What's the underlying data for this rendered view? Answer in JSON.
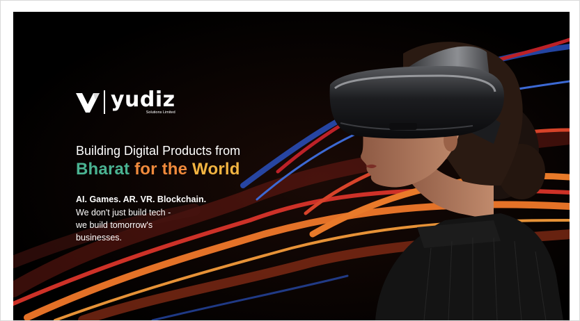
{
  "brand": {
    "name": "yudiz",
    "tagline": "Solutions Limited"
  },
  "headline": {
    "line1": "Building Digital Products from",
    "part_green": "Bharat",
    "part_orange": "for the",
    "part_yellow": "World"
  },
  "subheading": {
    "bold": "AI. Games. AR. VR. Blockchain.",
    "lines": [
      "We don't just build tech -",
      "we build tomorrow's",
      "businesses."
    ]
  },
  "colors": {
    "background": "#000000",
    "green": "#4ab392",
    "orange": "#f08a3c",
    "yellow": "#f3b441",
    "stream_red": "#d8342a",
    "stream_blue": "#2c55c8",
    "stream_orange": "#f0782a"
  },
  "image": {
    "subject": "woman-wearing-vr-headset"
  }
}
